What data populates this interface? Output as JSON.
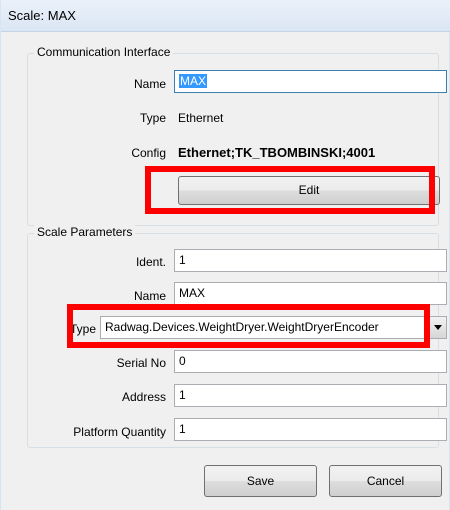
{
  "window": {
    "title": "Scale: MAX"
  },
  "communication": {
    "group_label": "Communication Interface",
    "name_label": "Name",
    "name_value": "MAX",
    "type_label": "Type",
    "type_value": "Ethernet",
    "config_label": "Config",
    "config_value": "Ethernet;TK_TBOMBINSKI;4001",
    "edit_button": "Edit"
  },
  "scale": {
    "group_label": "Scale Parameters",
    "ident_label": "Ident.",
    "ident_value": "1",
    "name_label": "Name",
    "name_value": "MAX",
    "type_label": "Type",
    "type_value": "Radwag.Devices.WeightDryer.WeightDryerEncoder",
    "serial_label": "Serial No",
    "serial_value": "0",
    "address_label": "Address",
    "address_value": "1",
    "platform_label": "Platform Quantity",
    "platform_value": "1"
  },
  "footer": {
    "save_button": "Save",
    "cancel_button": "Cancel"
  },
  "colors": {
    "highlight": "#ff0000",
    "selection": "#3399ff"
  }
}
